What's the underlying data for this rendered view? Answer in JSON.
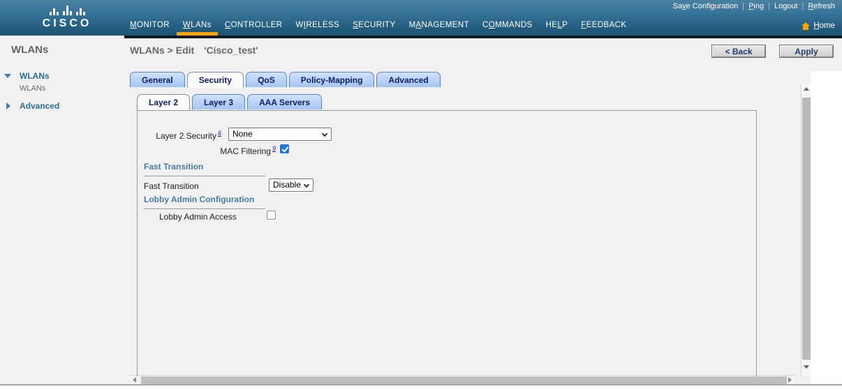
{
  "topbar": {
    "save_config": {
      "pre": "Sa",
      "key": "v",
      "post": "e Configuration"
    },
    "ping": {
      "pre": "",
      "key": "P",
      "post": "ing"
    },
    "logout": {
      "pre": "Logout",
      "key": "",
      "post": ""
    },
    "refresh": {
      "pre": "",
      "key": "R",
      "post": "efresh"
    },
    "sep": "|"
  },
  "brand": {
    "logo_text": "CISCO"
  },
  "nav": {
    "items": [
      {
        "pre": "",
        "key": "M",
        "post": "ONITOR"
      },
      {
        "pre": "",
        "key": "W",
        "post": "LANs"
      },
      {
        "pre": "",
        "key": "C",
        "post": "ONTROLLER"
      },
      {
        "pre": "W",
        "key": "I",
        "post": "RELESS"
      },
      {
        "pre": "",
        "key": "S",
        "post": "ECURITY"
      },
      {
        "pre": "M",
        "key": "A",
        "post": "NAGEMENT"
      },
      {
        "pre": "C",
        "key": "O",
        "post": "MMANDS"
      },
      {
        "pre": "HE",
        "key": "L",
        "post": "P"
      },
      {
        "pre": "",
        "key": "F",
        "post": "EEDBACK"
      }
    ],
    "active_item": "WLANs",
    "home": {
      "pre": "",
      "key": "H",
      "post": "ome"
    }
  },
  "sidebar": {
    "heading": "WLANs",
    "group_label": "WLANs",
    "child_label": "WLANs",
    "advanced_label": "Advanced"
  },
  "page": {
    "breadcrumb": "WLANs > Edit",
    "wlan_name": "'Cisco_test'",
    "back_button": "< Back",
    "apply_button": "Apply"
  },
  "tabs": {
    "main": [
      "General",
      "Security",
      "QoS",
      "Policy-Mapping",
      "Advanced"
    ],
    "main_active": "Security",
    "sub": [
      "Layer 2",
      "Layer 3",
      "AAA Servers"
    ],
    "sub_active": "Layer 2"
  },
  "form": {
    "layer2_security": {
      "label": "Layer 2 Security",
      "footnote": "6",
      "value": "None"
    },
    "mac_filtering": {
      "label": "MAC Filtering",
      "footnote": "9",
      "checked": true
    },
    "fast_transition_section": "Fast Transition",
    "fast_transition": {
      "label": "Fast Transition",
      "value": "Disable"
    },
    "lobby_section": "Lobby Admin Configuration",
    "lobby_admin": {
      "label": "Lobby Admin Access",
      "checked": false
    }
  },
  "colors": {
    "accent_orange": "#f7a300",
    "tab_blue": "#a5c6f1",
    "checkbox_blue": "#1b78e0",
    "header_gradient_top": "#4a81a0",
    "header_gradient_bottom": "#1d5472",
    "background_gray": "#f1f1f1"
  }
}
